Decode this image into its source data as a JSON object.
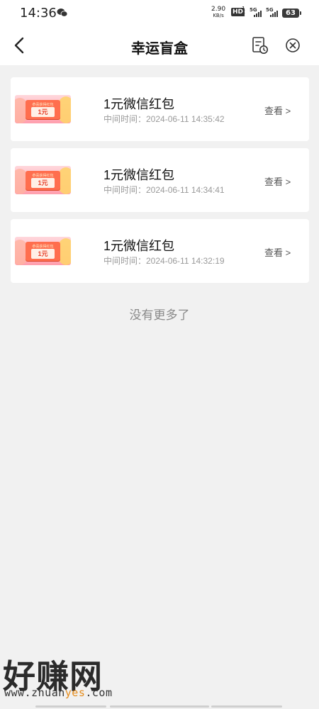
{
  "status_bar": {
    "time": "14:36",
    "net_speed_value": "2.90",
    "net_speed_unit": "KB/s",
    "hd_label": "HD",
    "hd_sub_top": "1",
    "hd_sub_bottom": "2",
    "signal1_label": "5G",
    "signal2_label": "5G",
    "battery_level": "63"
  },
  "nav": {
    "title": "幸运盲盒"
  },
  "items": [
    {
      "thumb_small": "恭喜获得红包",
      "thumb_amount": "1元",
      "title": "1元微信红包",
      "time": "中间时间：2024-06-11 14:35:42",
      "action": "查看 >"
    },
    {
      "thumb_small": "恭喜获得红包",
      "thumb_amount": "1元",
      "title": "1元微信红包",
      "time": "中间时间：2024-06-11 14:34:41",
      "action": "查看 >"
    },
    {
      "thumb_small": "恭喜获得红包",
      "thumb_amount": "1元",
      "title": "1元微信红包",
      "time": "中间时间：2024-06-11 14:32:19",
      "action": "查看 >"
    }
  ],
  "footer_text": "没有更多了",
  "watermark": {
    "main": "好赚网",
    "url_prefix": "www.zhuan",
    "url_highlight": "yes",
    "url_suffix": ".com"
  },
  "colors": {
    "background": "#f1f1f1",
    "card": "#ffffff",
    "ticket_red": "#ff6e4e",
    "watermark_accent": "#e58b1a"
  }
}
